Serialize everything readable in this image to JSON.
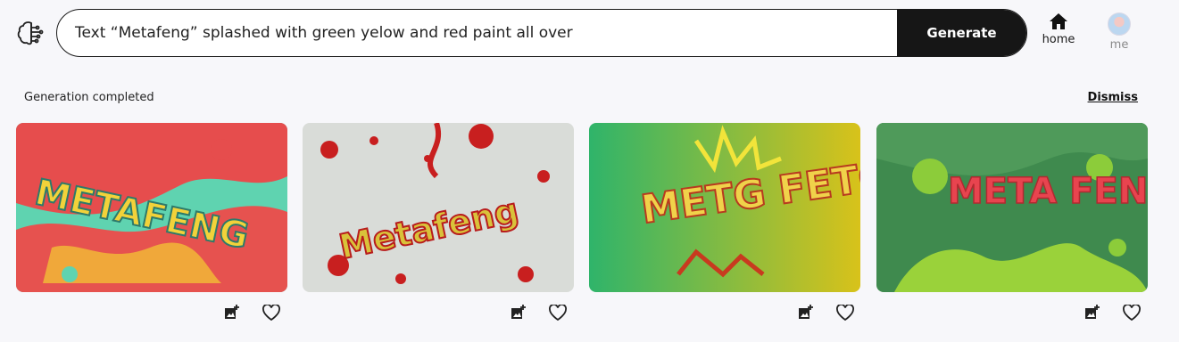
{
  "search": {
    "prompt": "Text “Metafeng” splashed with green yelow and red paint all over",
    "generate_label": "Generate"
  },
  "nav": {
    "home_label": "home",
    "me_label": "me"
  },
  "status": {
    "message": "Generation completed",
    "dismiss_label": "Dismiss"
  },
  "images": [
    {
      "text": "METAFENG",
      "icon": "image-placeholder"
    },
    {
      "text": "Metafeng",
      "icon": "image-placeholder"
    },
    {
      "text": "METG FETG",
      "icon": "image-placeholder"
    },
    {
      "text": "META FENG",
      "icon": "image-placeholder"
    }
  ],
  "colors": {
    "accent": "#161616",
    "background": "#f7f7fa"
  }
}
